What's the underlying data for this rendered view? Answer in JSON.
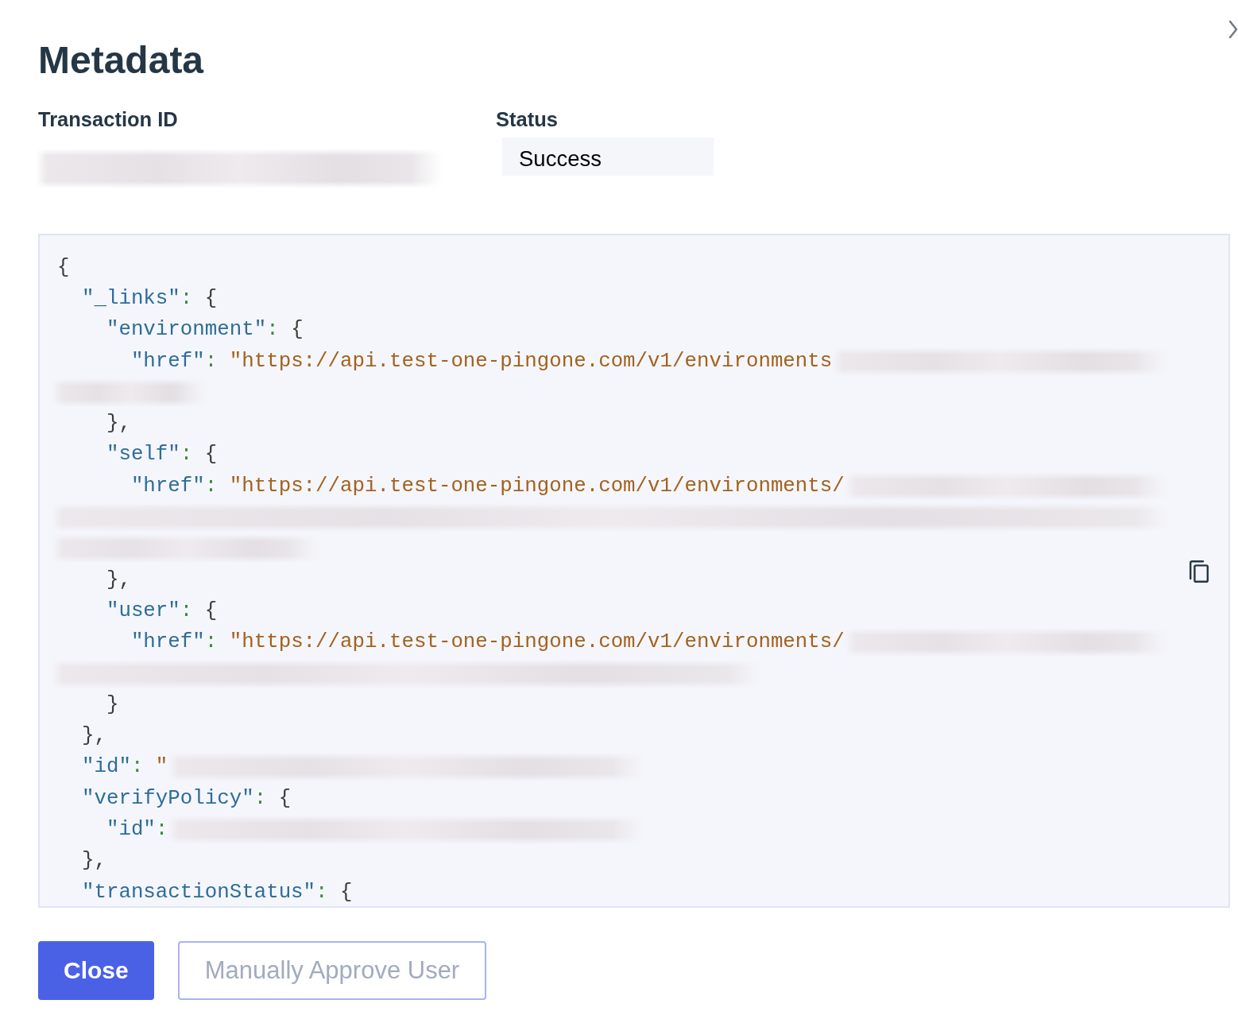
{
  "panel": {
    "title": "Metadata"
  },
  "fields": [
    {
      "kind": "redacted",
      "label": "Transaction ID"
    },
    {
      "kind": "readonly",
      "label": "Status",
      "value": "Success"
    }
  ],
  "code": {
    "lines": [
      {
        "kind": "plain",
        "text": "{"
      },
      {
        "kind": "plain",
        "text": "  \"_links\": {"
      },
      {
        "kind": "plain",
        "text": "    \"environment\": {"
      },
      {
        "kind": "masked",
        "text": "      \"href\": \"https://api.test-one-pingone.com/v1/environments"
      },
      {
        "kind": "blurshort"
      },
      {
        "kind": "plain",
        "text": "    },"
      },
      {
        "kind": "plain",
        "text": "    \"self\": {"
      },
      {
        "kind": "masked",
        "text": "      \"href\": \"https://api.test-one-pingone.com/v1/environments/"
      },
      {
        "kind": "blurfull"
      },
      {
        "kind": "blurmedium"
      },
      {
        "kind": "plain",
        "text": "    },"
      },
      {
        "kind": "plain",
        "text": "    \"user\": {"
      },
      {
        "kind": "masked",
        "text": "      \"href\": \"https://api.test-one-pingone.com/v1/environments/"
      },
      {
        "kind": "blurlong"
      },
      {
        "kind": "plain",
        "text": "    }"
      },
      {
        "kind": "plain",
        "text": "  },"
      },
      {
        "kind": "halfmasked",
        "text": "  \"id\": \""
      },
      {
        "kind": "plain",
        "text": "  \"verifyPolicy\": {"
      },
      {
        "kind": "halfmasked",
        "text": "    \"id\":"
      },
      {
        "kind": "plain",
        "text": "  },"
      },
      {
        "kind": "plain",
        "text": "  \"transactionStatus\": {"
      }
    ]
  },
  "buttons": [
    {
      "label": "Close",
      "kind": "primary",
      "disabled": false
    },
    {
      "label": "Manually Approve User",
      "kind": "secondary",
      "disabled": true
    }
  ]
}
